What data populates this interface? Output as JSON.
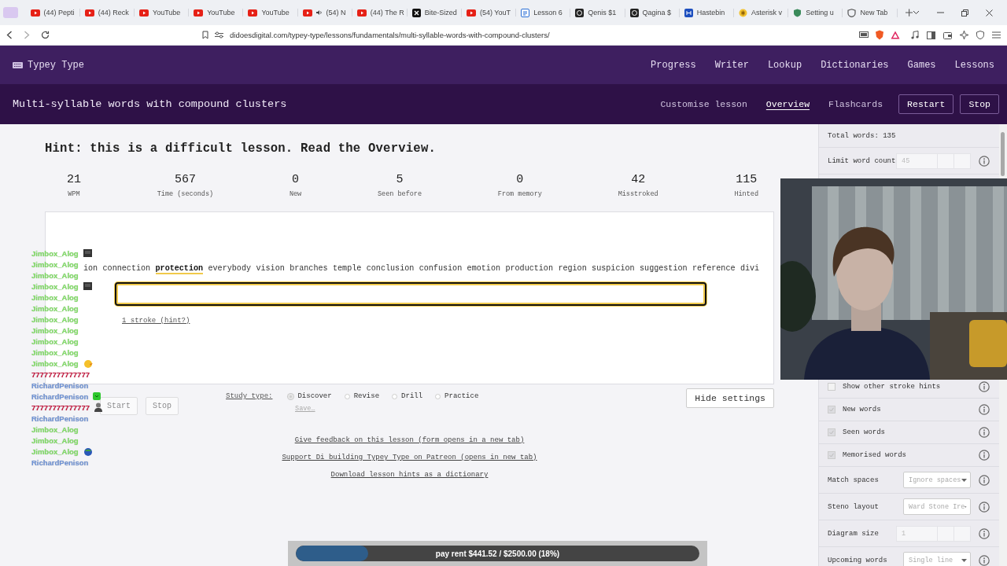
{
  "browser": {
    "tabs": [
      {
        "title": "(44) Pepti",
        "kind": "play"
      },
      {
        "title": "(44) Reck",
        "kind": "play"
      },
      {
        "title": "YouTube",
        "kind": "play"
      },
      {
        "title": "YouTube",
        "kind": "play"
      },
      {
        "title": "YouTube",
        "kind": "play"
      },
      {
        "title": "(54) N",
        "kind": "playaudio"
      },
      {
        "title": "(44) The R",
        "kind": "play"
      },
      {
        "title": "Bite-Sized",
        "kind": "x"
      },
      {
        "title": "(54) YouT",
        "kind": "play"
      },
      {
        "title": "Lesson 6",
        "kind": "doc"
      },
      {
        "title": "Qenis $1",
        "kind": "dark"
      },
      {
        "title": "Qagina $",
        "kind": "dark"
      },
      {
        "title": "Hastebin",
        "kind": "blue"
      },
      {
        "title": "Asterisk v",
        "kind": "yellow"
      },
      {
        "title": "Setting u",
        "kind": "green"
      },
      {
        "title": "New Tab",
        "kind": "shield"
      }
    ],
    "url": "didoesdigital.com/typey-type/lessons/fundamentals/multi-syllable-words-with-compound-clusters/"
  },
  "nav": {
    "brand": "Typey Type",
    "links": [
      "Progress",
      "Writer",
      "Lookup",
      "Dictionaries",
      "Games",
      "Lessons"
    ]
  },
  "lesson": {
    "title": "Multi-syllable words with compound clusters",
    "links": [
      {
        "label": "Customise lesson",
        "selected": false
      },
      {
        "label": "Overview",
        "selected": true
      },
      {
        "label": "Flashcards",
        "selected": false
      }
    ],
    "buttons": [
      "Restart",
      "Stop"
    ]
  },
  "hint": "Hint: this is a difficult lesson. Read the Overview.",
  "stats": [
    {
      "value": "21",
      "label": "WPM"
    },
    {
      "value": "567",
      "label": "Time (seconds)"
    },
    {
      "value": "0",
      "label": "New"
    },
    {
      "value": "5",
      "label": "Seen before"
    },
    {
      "value": "0",
      "label": "From memory"
    },
    {
      "value": "42",
      "label": "Misstroked"
    },
    {
      "value": "115",
      "label": "Hinted"
    }
  ],
  "material": [
    {
      "text": "ion",
      "selected": false
    },
    {
      "text": "connection",
      "selected": false
    },
    {
      "text": "protection",
      "selected": true
    },
    {
      "text": "everybody",
      "selected": false
    },
    {
      "text": "vision",
      "selected": false
    },
    {
      "text": "branches",
      "selected": false
    },
    {
      "text": "temple",
      "selected": false
    },
    {
      "text": "conclusion",
      "selected": false
    },
    {
      "text": "confusion",
      "selected": false
    },
    {
      "text": "emotion",
      "selected": false
    },
    {
      "text": "production",
      "selected": false
    },
    {
      "text": "region",
      "selected": false
    },
    {
      "text": "suspicion",
      "selected": false
    },
    {
      "text": "suggestion",
      "selected": false
    },
    {
      "text": "reference",
      "selected": false
    },
    {
      "text": "divi",
      "selected": false
    }
  ],
  "stroke_hint": "1 stroke (hint?)",
  "run_buttons": [
    "Start",
    "Stop"
  ],
  "study_type": {
    "label": "Study type:",
    "options": [
      {
        "label": "Discover",
        "selected": true
      },
      {
        "label": "Revise",
        "selected": false
      },
      {
        "label": "Drill",
        "selected": false
      },
      {
        "label": "Practice",
        "selected": false
      }
    ],
    "save": "Save…"
  },
  "hide_settings": "Hide settings",
  "links": [
    "Give feedback on this lesson (form opens in a new tab)",
    "Support Di building Typey Type on Patreon (opens in new tab)",
    "Download lesson hints as a dictionary"
  ],
  "sidebar": {
    "top_rows": [
      {
        "kind": "text",
        "label": "Total words: 135"
      },
      {
        "kind": "number",
        "label": "Limit word count",
        "value": "45"
      }
    ],
    "rows": [
      {
        "kind": "checkbox",
        "label": "Show other stroke hints",
        "checked": false
      },
      {
        "kind": "checkbox",
        "label": "New words",
        "checked": true
      },
      {
        "kind": "checkbox",
        "label": "Seen words",
        "checked": true
      },
      {
        "kind": "checkbox",
        "label": "Memorised words",
        "checked": true
      },
      {
        "kind": "select",
        "label": "Match spaces",
        "value": "Ignore spaces"
      },
      {
        "kind": "select",
        "label": "Steno layout",
        "value": "Ward Stone Ire"
      },
      {
        "kind": "number",
        "label": "Diagram size",
        "value": "1"
      },
      {
        "kind": "select",
        "label": "Upcoming words",
        "value": "Single line"
      }
    ]
  },
  "chat": [
    {
      "user": "Jimbox_Alog",
      "color": "#7ee062",
      "kind": "dark"
    },
    {
      "user": "Jimbox_Alog",
      "color": "#7ee062"
    },
    {
      "user": "Jimbox_Alog",
      "color": "#7ee062"
    },
    {
      "user": "Jimbox_Alog",
      "color": "#7ee062",
      "kind": "dark"
    },
    {
      "user": "Jimbox_Alog",
      "color": "#7ee062"
    },
    {
      "user": "Jimbox_Alog",
      "color": "#7ee062"
    },
    {
      "user": "Jimbox_Alog",
      "color": "#7ee062"
    },
    {
      "user": "Jimbox_Alog",
      "color": "#7ee062"
    },
    {
      "user": "Jimbox_Alog",
      "color": "#7ee062"
    },
    {
      "user": "Jimbox_Alog",
      "color": "#7ee062"
    },
    {
      "user": "Jimbox_Alog",
      "color": "#7ee062",
      "kind": "duck"
    },
    {
      "user": "77777777777777",
      "color": "#c8143c"
    },
    {
      "user": "RichardPenison",
      "color": "#6f94d8"
    },
    {
      "user": "RichardPenison",
      "color": "#6f94d8",
      "kind": "green"
    },
    {
      "user": "77777777777777",
      "color": "#c8143c",
      "kind": "figure"
    },
    {
      "user": "RichardPenison",
      "color": "#6f94d8"
    },
    {
      "user": "Jimbox_Alog",
      "color": "#7ee062"
    },
    {
      "user": "Jimbox_Alog",
      "color": "#7ee062"
    },
    {
      "user": "Jimbox_Alog",
      "color": "#7ee062",
      "kind": "blue"
    },
    {
      "user": "RichardPenison",
      "color": "#6f94d8"
    }
  ],
  "webcam": {
    "kind": "picture"
  },
  "donation": {
    "text": "pay rent $441.52 / $2500.00 (18%)",
    "level": 0.18
  }
}
